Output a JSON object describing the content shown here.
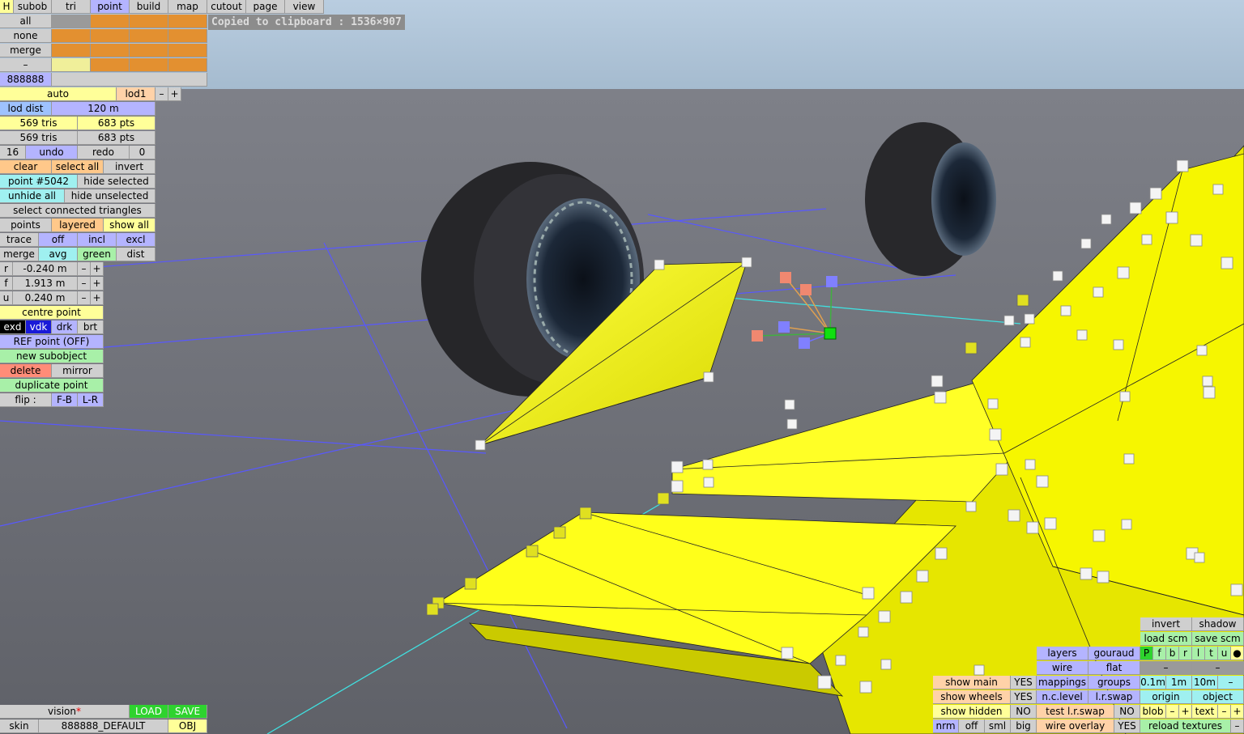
{
  "tabs": {
    "h": "H",
    "subob": "subob",
    "tri": "tri",
    "point": "point",
    "build": "build",
    "map": "map",
    "cutout": "cutout",
    "page": "page",
    "view": "view"
  },
  "status_message": "Copied to clipboard : 1536×907",
  "select": {
    "all": "all",
    "none": "none",
    "merge": "merge",
    "dash": "–",
    "color_code": "888888"
  },
  "lod": {
    "mode": "auto",
    "name": "lod1",
    "minus": "–",
    "plus": "+",
    "dist_label": "lod dist",
    "dist_value": "120 m"
  },
  "counts": {
    "tris1": "569 tris",
    "pts1": "683 pts",
    "tris2": "569 tris",
    "pts2": "683 pts"
  },
  "history": {
    "undo_count": "16",
    "undo": "undo",
    "redo": "redo",
    "redo_count": "0"
  },
  "selection": {
    "clear": "clear",
    "select_all": "select all",
    "invert": "invert",
    "point_id": "point #5042",
    "hide_selected": "hide selected",
    "unhide_all": "unhide all",
    "hide_unselected": "hide unselected",
    "select_connected": "select connected triangles"
  },
  "modes": {
    "points": "points",
    "layered": "layered",
    "show_all": "show all",
    "trace": "trace",
    "off": "off",
    "incl": "incl",
    "excl": "excl",
    "merge": "merge",
    "avg": "avg",
    "green": "green",
    "dist": "dist"
  },
  "coords": {
    "r_label": "r",
    "r_value": "-0.240 m",
    "f_label": "f",
    "f_value": "1.913 m",
    "u_label": "u",
    "u_value": "0.240 m",
    "minus": "–",
    "plus": "+"
  },
  "actions": {
    "centre_point": "centre point",
    "exd": "exd",
    "vdk": "vdk",
    "drk": "drk",
    "brt": "brt",
    "ref_point": "REF point (OFF)",
    "new_subobject": "new subobject",
    "delete": "delete",
    "mirror": "mirror",
    "duplicate_point": "duplicate point",
    "flip_label": "flip :",
    "flip_fb": "F-B",
    "flip_lr": "L-R"
  },
  "bottom_left": {
    "vision": "vision",
    "vision_mark": "*",
    "load": "LOAD",
    "save": "SAVE",
    "skin_label": "skin",
    "skin_value": "888888_DEFAULT",
    "obj": "OBJ"
  },
  "bottom_right": {
    "invert": "invert",
    "shadow": "shadow",
    "load_scm": "load scm",
    "save_scm": "save scm",
    "layers": "layers",
    "gouraud": "gouraud",
    "letters": [
      "P",
      "f",
      "b",
      "r",
      "l",
      "t",
      "u",
      "●"
    ],
    "wire": "wire",
    "flat": "flat",
    "dash": "–",
    "show_main": "show main",
    "yes": "YES",
    "mappings": "mappings",
    "groups": "groups",
    "s01": "0.1m",
    "s1": "1m",
    "s10": "10m",
    "minus": "–",
    "show_wheels": "show wheels",
    "nc_level": "n.c.level",
    "lr_swap": "l.r.swap",
    "origin": "origin",
    "object": "object",
    "show_hidden": "show hidden",
    "no": "NO",
    "test_lr_swap": "test l.r.swap",
    "blob": "blob",
    "plus": "+",
    "text": "text",
    "nrm": "nrm",
    "off": "off",
    "sml": "sml",
    "big": "big",
    "wire_overlay": "wire overlay",
    "reload_textures": "reload textures"
  },
  "colors": {
    "sky": "#a9bfd2",
    "ground": "#6a6c72",
    "model": "#ffff1a",
    "grid": "#6060ff",
    "tire": "#2c2c30"
  }
}
